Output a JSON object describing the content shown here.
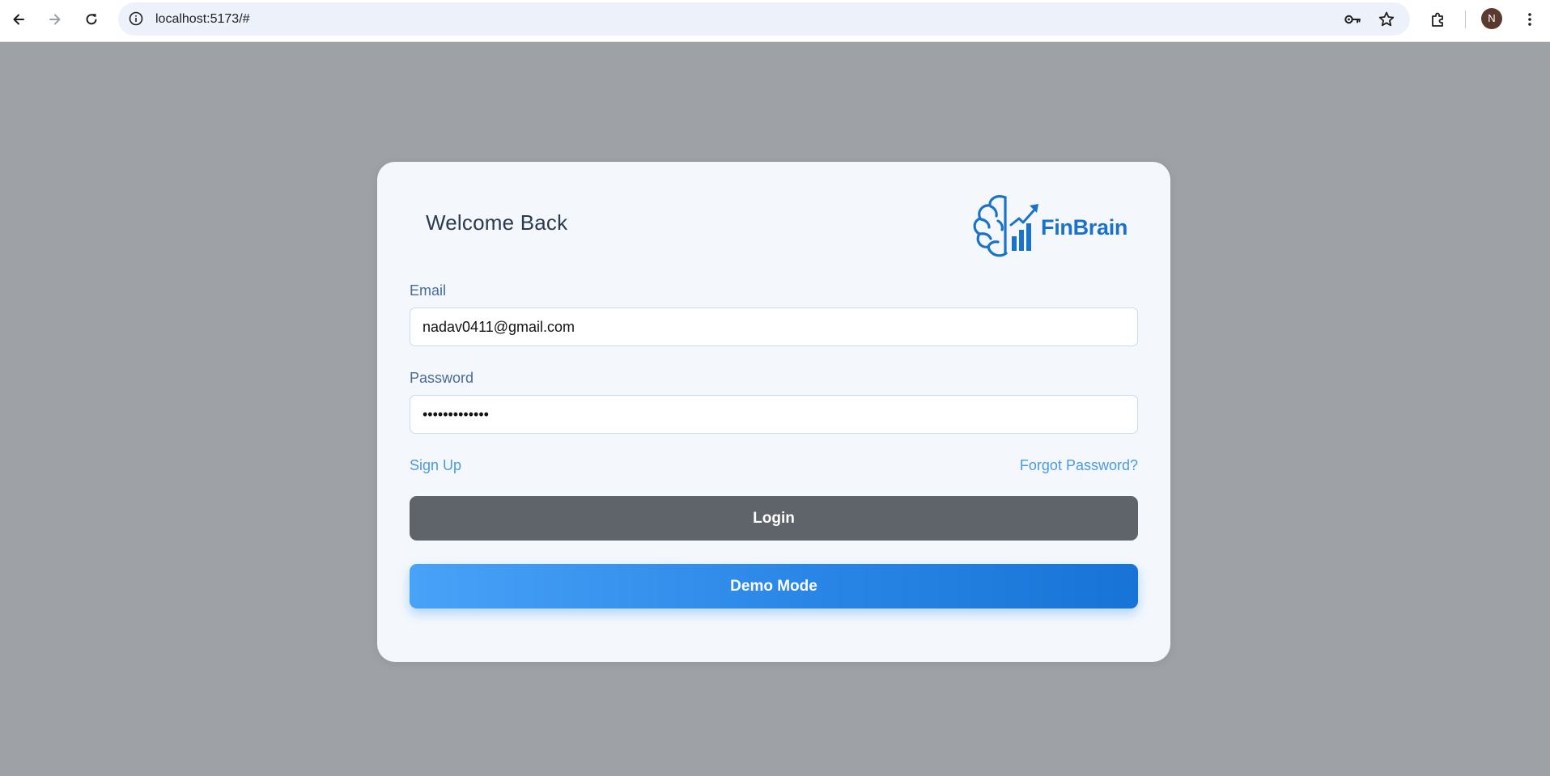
{
  "browser": {
    "url": "localhost:5173/#",
    "profile_initial": "N",
    "icons": {
      "back": "back-arrow-icon",
      "forward": "forward-arrow-icon",
      "reload": "reload-icon",
      "site_info": "info-icon",
      "password": "key-icon",
      "bookmark": "star-icon",
      "extensions": "puzzle-icon",
      "menu": "kebab-menu-icon"
    }
  },
  "login": {
    "title": "Welcome Back",
    "brand": "FinBrain",
    "email_label": "Email",
    "email_value": "nadav0411@gmail.com",
    "password_label": "Password",
    "password_value": "•••••••••••••",
    "signup_link": "Sign Up",
    "forgot_link": "Forgot Password?",
    "login_button": "Login",
    "demo_button": "Demo Mode"
  },
  "colors": {
    "page_overlay": "#9ea1a6",
    "card_background": "#f4f8fc",
    "brand_blue": "#1a73c9",
    "link_blue": "#4a9ae6",
    "login_button": "#5f636a",
    "demo_gradient_start": "#48a2f8",
    "demo_gradient_end": "#1774d6"
  }
}
